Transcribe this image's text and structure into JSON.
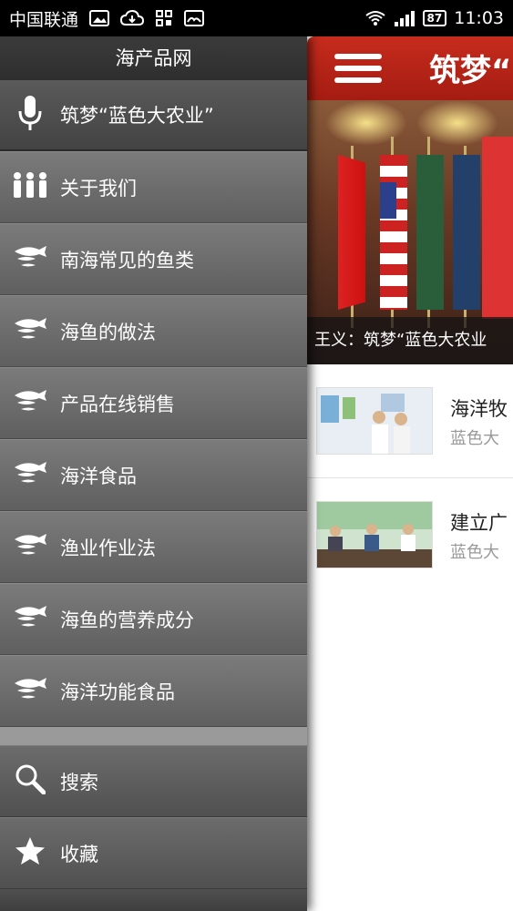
{
  "status_bar": {
    "carrier": "中国联通",
    "battery": "87",
    "time": "11:03"
  },
  "drawer": {
    "title": "海产品网",
    "voice_item": "筑梦“蓝色大农业”",
    "menu_items": [
      {
        "label": "关于我们",
        "icon": "people-icon"
      },
      {
        "label": "南海常见的鱼类",
        "icon": "fish-icon"
      },
      {
        "label": "海鱼的做法",
        "icon": "fish-icon"
      },
      {
        "label": "产品在线销售",
        "icon": "fish-icon"
      },
      {
        "label": "海洋食品",
        "icon": "fish-icon"
      },
      {
        "label": "渔业作业法",
        "icon": "fish-icon"
      },
      {
        "label": "海鱼的营养成分",
        "icon": "fish-icon"
      },
      {
        "label": "海洋功能食品",
        "icon": "fish-icon"
      }
    ],
    "bottom_items": [
      {
        "label": "搜索",
        "icon": "search-icon"
      },
      {
        "label": "收藏",
        "icon": "star-icon"
      }
    ]
  },
  "content": {
    "header_title": "筑梦“",
    "hero_caption": "王义：筑梦“蓝色大农业",
    "news": [
      {
        "title": "海洋牧",
        "subtitle": "蓝色大"
      },
      {
        "title": "建立广",
        "subtitle": "蓝色大"
      }
    ]
  },
  "colors": {
    "header_red": "#b8261a",
    "drawer_gray": "#6a6a6a"
  }
}
